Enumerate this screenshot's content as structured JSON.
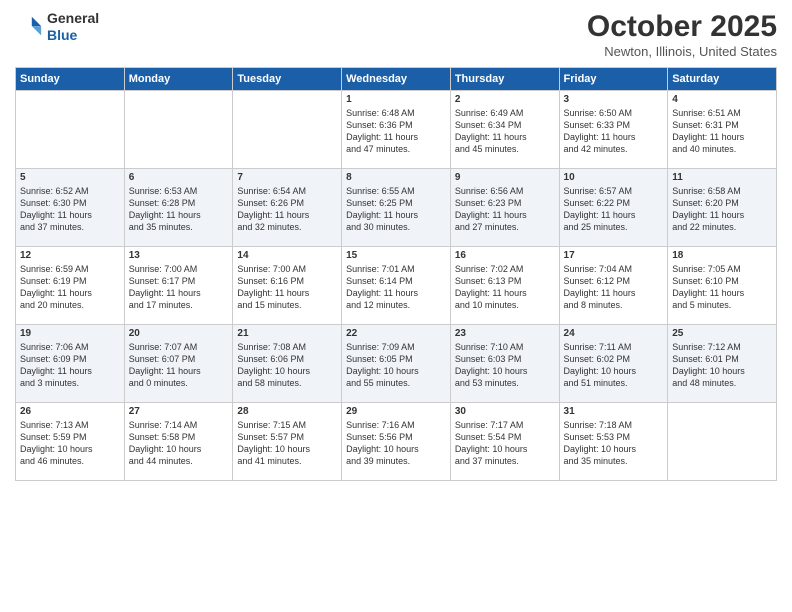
{
  "logo": {
    "line1": "General",
    "line2": "Blue"
  },
  "title": "October 2025",
  "subtitle": "Newton, Illinois, United States",
  "weekdays": [
    "Sunday",
    "Monday",
    "Tuesday",
    "Wednesday",
    "Thursday",
    "Friday",
    "Saturday"
  ],
  "weeks": [
    [
      {
        "day": "",
        "content": ""
      },
      {
        "day": "",
        "content": ""
      },
      {
        "day": "",
        "content": ""
      },
      {
        "day": "1",
        "content": "Sunrise: 6:48 AM\nSunset: 6:36 PM\nDaylight: 11 hours\nand 47 minutes."
      },
      {
        "day": "2",
        "content": "Sunrise: 6:49 AM\nSunset: 6:34 PM\nDaylight: 11 hours\nand 45 minutes."
      },
      {
        "day": "3",
        "content": "Sunrise: 6:50 AM\nSunset: 6:33 PM\nDaylight: 11 hours\nand 42 minutes."
      },
      {
        "day": "4",
        "content": "Sunrise: 6:51 AM\nSunset: 6:31 PM\nDaylight: 11 hours\nand 40 minutes."
      }
    ],
    [
      {
        "day": "5",
        "content": "Sunrise: 6:52 AM\nSunset: 6:30 PM\nDaylight: 11 hours\nand 37 minutes."
      },
      {
        "day": "6",
        "content": "Sunrise: 6:53 AM\nSunset: 6:28 PM\nDaylight: 11 hours\nand 35 minutes."
      },
      {
        "day": "7",
        "content": "Sunrise: 6:54 AM\nSunset: 6:26 PM\nDaylight: 11 hours\nand 32 minutes."
      },
      {
        "day": "8",
        "content": "Sunrise: 6:55 AM\nSunset: 6:25 PM\nDaylight: 11 hours\nand 30 minutes."
      },
      {
        "day": "9",
        "content": "Sunrise: 6:56 AM\nSunset: 6:23 PM\nDaylight: 11 hours\nand 27 minutes."
      },
      {
        "day": "10",
        "content": "Sunrise: 6:57 AM\nSunset: 6:22 PM\nDaylight: 11 hours\nand 25 minutes."
      },
      {
        "day": "11",
        "content": "Sunrise: 6:58 AM\nSunset: 6:20 PM\nDaylight: 11 hours\nand 22 minutes."
      }
    ],
    [
      {
        "day": "12",
        "content": "Sunrise: 6:59 AM\nSunset: 6:19 PM\nDaylight: 11 hours\nand 20 minutes."
      },
      {
        "day": "13",
        "content": "Sunrise: 7:00 AM\nSunset: 6:17 PM\nDaylight: 11 hours\nand 17 minutes."
      },
      {
        "day": "14",
        "content": "Sunrise: 7:00 AM\nSunset: 6:16 PM\nDaylight: 11 hours\nand 15 minutes."
      },
      {
        "day": "15",
        "content": "Sunrise: 7:01 AM\nSunset: 6:14 PM\nDaylight: 11 hours\nand 12 minutes."
      },
      {
        "day": "16",
        "content": "Sunrise: 7:02 AM\nSunset: 6:13 PM\nDaylight: 11 hours\nand 10 minutes."
      },
      {
        "day": "17",
        "content": "Sunrise: 7:04 AM\nSunset: 6:12 PM\nDaylight: 11 hours\nand 8 minutes."
      },
      {
        "day": "18",
        "content": "Sunrise: 7:05 AM\nSunset: 6:10 PM\nDaylight: 11 hours\nand 5 minutes."
      }
    ],
    [
      {
        "day": "19",
        "content": "Sunrise: 7:06 AM\nSunset: 6:09 PM\nDaylight: 11 hours\nand 3 minutes."
      },
      {
        "day": "20",
        "content": "Sunrise: 7:07 AM\nSunset: 6:07 PM\nDaylight: 11 hours\nand 0 minutes."
      },
      {
        "day": "21",
        "content": "Sunrise: 7:08 AM\nSunset: 6:06 PM\nDaylight: 10 hours\nand 58 minutes."
      },
      {
        "day": "22",
        "content": "Sunrise: 7:09 AM\nSunset: 6:05 PM\nDaylight: 10 hours\nand 55 minutes."
      },
      {
        "day": "23",
        "content": "Sunrise: 7:10 AM\nSunset: 6:03 PM\nDaylight: 10 hours\nand 53 minutes."
      },
      {
        "day": "24",
        "content": "Sunrise: 7:11 AM\nSunset: 6:02 PM\nDaylight: 10 hours\nand 51 minutes."
      },
      {
        "day": "25",
        "content": "Sunrise: 7:12 AM\nSunset: 6:01 PM\nDaylight: 10 hours\nand 48 minutes."
      }
    ],
    [
      {
        "day": "26",
        "content": "Sunrise: 7:13 AM\nSunset: 5:59 PM\nDaylight: 10 hours\nand 46 minutes."
      },
      {
        "day": "27",
        "content": "Sunrise: 7:14 AM\nSunset: 5:58 PM\nDaylight: 10 hours\nand 44 minutes."
      },
      {
        "day": "28",
        "content": "Sunrise: 7:15 AM\nSunset: 5:57 PM\nDaylight: 10 hours\nand 41 minutes."
      },
      {
        "day": "29",
        "content": "Sunrise: 7:16 AM\nSunset: 5:56 PM\nDaylight: 10 hours\nand 39 minutes."
      },
      {
        "day": "30",
        "content": "Sunrise: 7:17 AM\nSunset: 5:54 PM\nDaylight: 10 hours\nand 37 minutes."
      },
      {
        "day": "31",
        "content": "Sunrise: 7:18 AM\nSunset: 5:53 PM\nDaylight: 10 hours\nand 35 minutes."
      },
      {
        "day": "",
        "content": ""
      }
    ]
  ]
}
